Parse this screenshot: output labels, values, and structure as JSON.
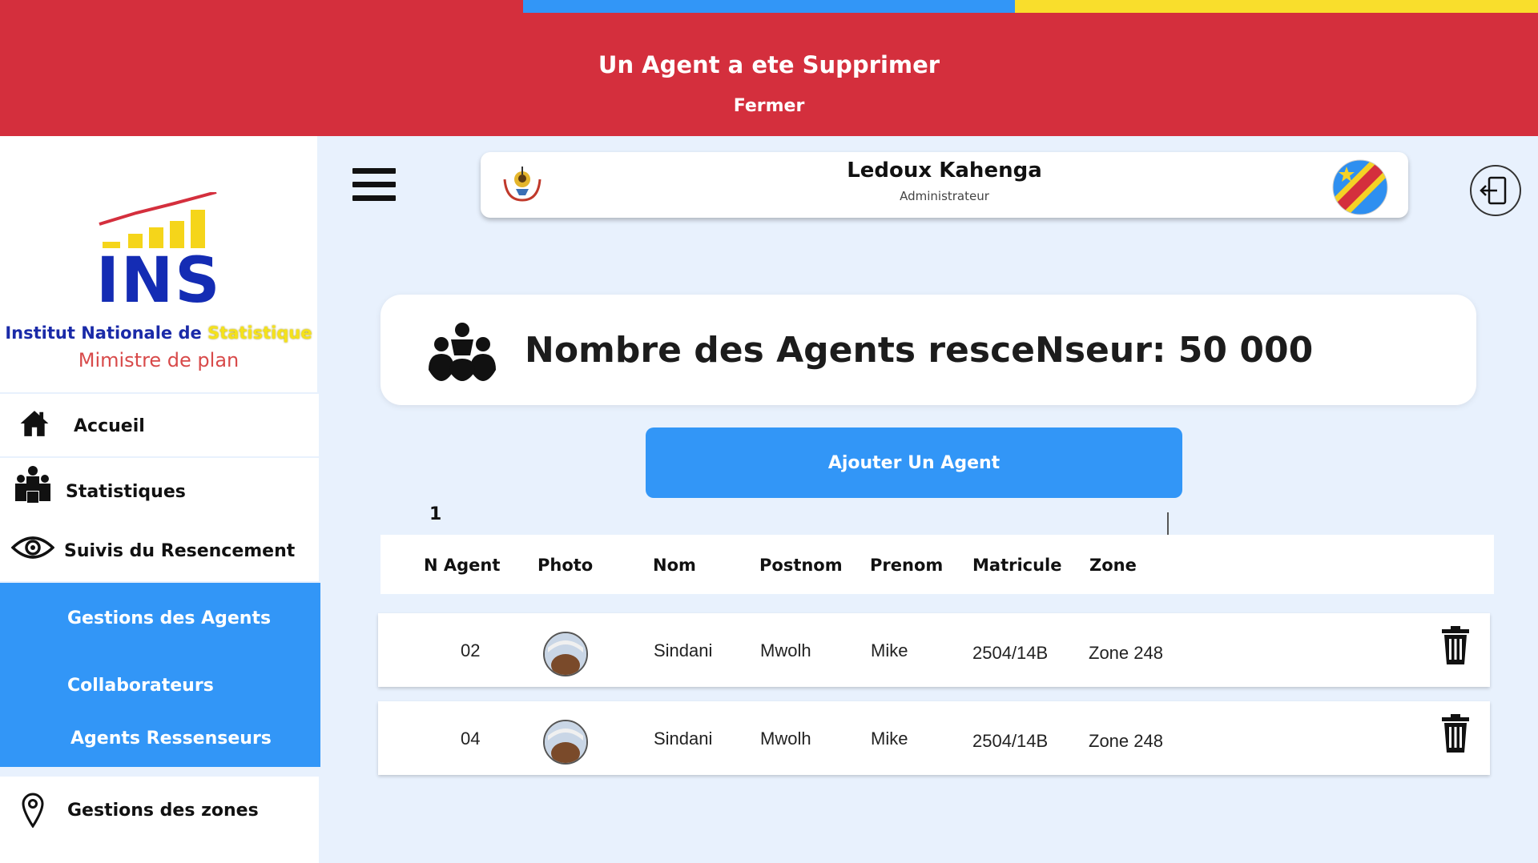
{
  "banner": {
    "message": "Un Agent a ete Supprimer",
    "close_label": "Fermer",
    "colors": {
      "background": "#d42f3d",
      "stripe_blue": "#3296f7",
      "stripe_yellow": "#f9de2c"
    }
  },
  "logo": {
    "ins": "INS",
    "org_part1": "Institut Nationale de ",
    "org_part2": "Statistique",
    "subtitle": "Mimistre de plan"
  },
  "sidebar": {
    "items": [
      {
        "label": "Accueil",
        "icon": "home-icon"
      },
      {
        "label": "Statistiques",
        "icon": "people-group-icon"
      },
      {
        "label": "Suivis du Resencement",
        "icon": "eye-icon"
      }
    ],
    "submenu": [
      {
        "label": "Gestions des Agents"
      },
      {
        "label": "Collaborateurs"
      },
      {
        "label": "Agents Ressenseurs"
      }
    ],
    "zones": {
      "label": "Gestions des zones",
      "icon": "map-pin-icon"
    },
    "accent": "#3296f7"
  },
  "header": {
    "user_name": "Ledoux Kahenga",
    "user_role": "Administrateur",
    "icons": [
      "menu-icon",
      "coat-of-arms-icon",
      "drc-flag-icon",
      "logout-icon"
    ]
  },
  "stats": {
    "text": "Nombre des Agents resceNseur: 50 000",
    "icon": "agents-group-icon"
  },
  "actions": {
    "add_agent": "Ajouter Un Agent"
  },
  "pagination": {
    "page": "1"
  },
  "table": {
    "columns": [
      "N Agent",
      "Photo",
      "Nom",
      "Postnom",
      "Prenom",
      "Matricule",
      "Zone"
    ],
    "rows": [
      {
        "n": "02",
        "nom": "Sindani",
        "postnom": "Mwolh",
        "prenom": "Mike",
        "matricule": "2504/14B",
        "zone": "Zone 248"
      },
      {
        "n": "04",
        "nom": "Sindani",
        "postnom": "Mwolh",
        "prenom": "Mike",
        "matricule": "2504/14B",
        "zone": "Zone 248"
      }
    ]
  }
}
